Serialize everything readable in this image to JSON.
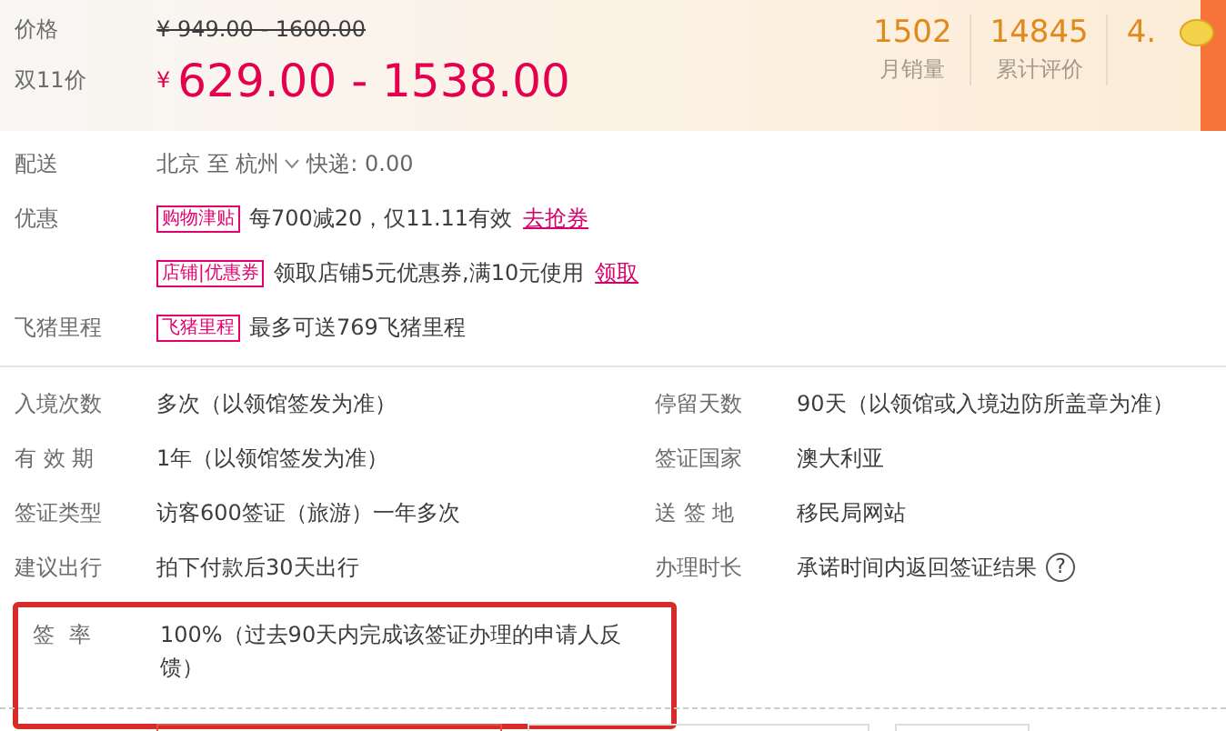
{
  "price": {
    "label": "价格",
    "original": "¥ 949.00 - 1600.00"
  },
  "promo_price": {
    "label": "双11价",
    "currency": "¥",
    "value": "629.00 - 1538.00"
  },
  "stats": [
    {
      "value": "1502",
      "label": "月销量"
    },
    {
      "value": "14845",
      "label": "累计评价"
    },
    {
      "value": "4."
    }
  ],
  "delivery": {
    "label": "配送",
    "route": "北京 至 杭州",
    "shipping": "快递: 0.00"
  },
  "offers": [
    {
      "label": "优惠",
      "tag": "购物津贴",
      "text": "每700减20，仅11.11有效",
      "link": "去抢券"
    },
    {
      "tag": "店铺|优惠券",
      "text": "领取店铺5元优惠券,满10元使用",
      "link": "领取"
    },
    {
      "label": "飞猪里程",
      "tag": "飞猪里程",
      "text": "最多可送769飞猪里程"
    }
  ],
  "attributes": [
    {
      "label": "入境次数",
      "value": "多次（以领馆签发为准）"
    },
    {
      "label": "停留天数",
      "value": "90天（以领馆或入境边防所盖章为准）"
    },
    {
      "label": "有 效 期",
      "value": "1年（以领馆签发为准）"
    },
    {
      "label": "签证国家",
      "value": "澳大利亚"
    },
    {
      "label": "签证类型",
      "value": "访客600签证（旅游）一年多次"
    },
    {
      "label": "送 签 地",
      "value": "移民局网站"
    },
    {
      "label": "建议出行",
      "value": "拍下付款后30天出行"
    },
    {
      "label": "办理时长",
      "value": "承诺时间内返回签证结果",
      "help": "?"
    }
  ],
  "highlight": {
    "label": "签 率",
    "value": "100%（过去90天内完成该签证办理的申请人反馈）"
  },
  "bottom_buttons": [
    {
      "selected": true
    },
    {
      "selected": false
    },
    {
      "selected": false
    }
  ]
}
